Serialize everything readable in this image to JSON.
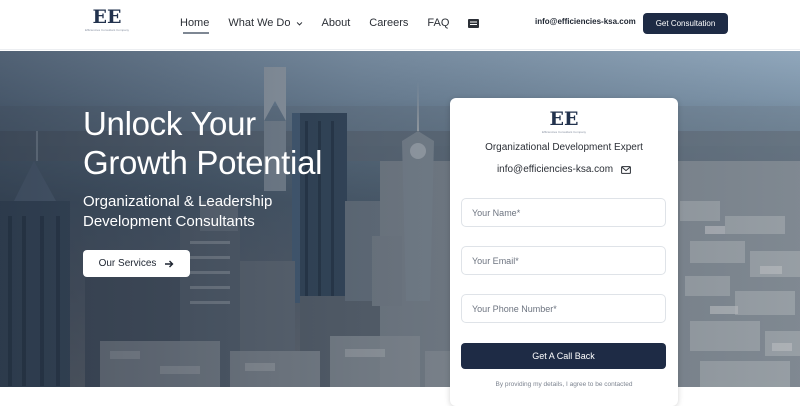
{
  "header": {
    "logo": {
      "mark": "EE",
      "tagline": "Efficiencies Consultant Company"
    },
    "nav": [
      {
        "label": "Home",
        "active": true
      },
      {
        "label": "What We Do",
        "has_dropdown": true
      },
      {
        "label": "About"
      },
      {
        "label": "Careers"
      },
      {
        "label": "FAQ"
      }
    ],
    "menu_icon": "menu-card-icon",
    "email": "info@efficiencies-ksa.com",
    "cta_label": "Get Consultation"
  },
  "hero": {
    "title_line1": "Unlock Your",
    "title_line2": "Growth Potential",
    "subtitle_line1": "Organizational & Leadership",
    "subtitle_line2": "Development Consultants",
    "button_label": "Our Services",
    "button_icon": "arrow-right-icon"
  },
  "form": {
    "logo_mark": "EE",
    "logo_tagline": "Efficiencies Consultant Company",
    "heading": "Organizational Development Expert",
    "email": "info@efficiencies-ksa.com",
    "email_icon": "envelope-icon",
    "name_placeholder": "Your Name*",
    "email_placeholder": "Your Email*",
    "phone_placeholder": "Your Phone Number*",
    "submit_label": "Get A Call Back",
    "consent_text": "By providing my details, I agree to be contacted"
  },
  "colors": {
    "brand_navy": "#1e2b45",
    "text_dark": "#2b2f36",
    "white": "#ffffff"
  }
}
